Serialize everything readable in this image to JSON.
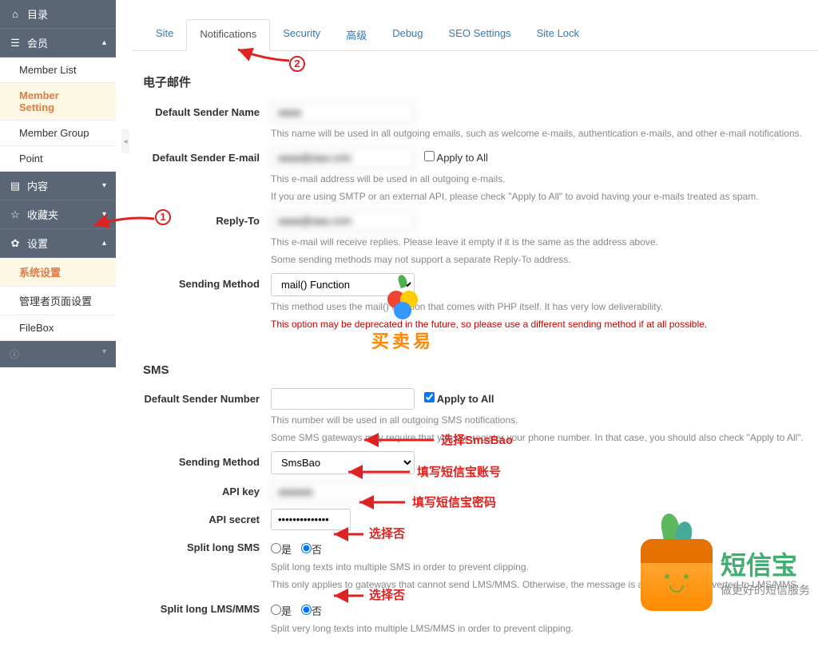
{
  "sidebar": {
    "section0": {
      "label": "目录"
    },
    "section1": {
      "label": "会员",
      "items": [
        {
          "label": "Member List"
        },
        {
          "label": "Member Setting"
        },
        {
          "label": "Member Group"
        },
        {
          "label": "Point"
        }
      ]
    },
    "section2": {
      "label": "内容"
    },
    "section3": {
      "label": "收藏夹"
    },
    "section4": {
      "label": "设置",
      "items": [
        {
          "label": "系统设置"
        },
        {
          "label": "管理者页面设置"
        },
        {
          "label": "FileBox"
        }
      ]
    }
  },
  "tabs": [
    {
      "label": "Site"
    },
    {
      "label": "Notifications"
    },
    {
      "label": "Security"
    },
    {
      "label": "高级"
    },
    {
      "label": "Debug"
    },
    {
      "label": "SEO Settings"
    },
    {
      "label": "Site Lock"
    }
  ],
  "email": {
    "title": "电子邮件",
    "sender_name": {
      "label": "Default Sender Name",
      "value": "aaaa",
      "desc": "This name will be used in all outgoing emails, such as welcome e-mails, authentication e-mails, and other e-mail notifications."
    },
    "sender_email": {
      "label": "Default Sender E-mail",
      "value": "aaaa@aaa.com",
      "apply_all": "Apply to All",
      "desc1": "This e-mail address will be used in all outgoing e-mails.",
      "desc2": "If you are using SMTP or an external API, please check \"Apply to All\" to avoid having your e-mails treated as spam."
    },
    "reply_to": {
      "label": "Reply-To",
      "value": "aaaa@aaa.com",
      "desc1": "This e-mail will receive replies. Please leave it empty if it is the same as the address above.",
      "desc2": "Some sending methods may not support a separate Reply-To address."
    },
    "sending_method": {
      "label": "Sending Method",
      "value": "mail() Function",
      "desc": "This method uses the mail() function that comes with PHP itself. It has very low deliverability.",
      "warn": "This option may be deprecated in the future, so please use a different sending method if at all possible."
    }
  },
  "sms": {
    "title": "SMS",
    "sender_number": {
      "label": "Default Sender Number",
      "value": "",
      "apply_all": "Apply to All",
      "desc1": "This number will be used in all outgoing SMS notifications.",
      "desc2": "Some SMS gateways may require that you pre-register your phone number. In that case, you should also check \"Apply to All\"."
    },
    "sending_method": {
      "label": "Sending Method",
      "value": "SmsBao"
    },
    "api_key": {
      "label": "API key",
      "value": "aaaaaa"
    },
    "api_secret": {
      "label": "API secret",
      "value": "••••••••••••••"
    },
    "split_sms": {
      "label": "Split long SMS",
      "yes": "是",
      "no": "否",
      "desc1": "Split long texts into multiple SMS in order to prevent clipping.",
      "desc2": "This only applies to gateways that cannot send LMS/MMS. Otherwise, the message is automatically converted to LMS/MMS."
    },
    "split_lms": {
      "label": "Split long LMS/MMS",
      "yes": "是",
      "no": "否",
      "desc1": "Split very long texts into multiple LMS/MMS in order to prevent clipping."
    }
  },
  "watermark": {
    "text": "买卖易"
  },
  "annotations": {
    "select_smsbao": "选择SmsBao",
    "fill_account": "填写短信宝账号",
    "fill_password": "填写短信宝密码",
    "select_no1": "选择否",
    "select_no2": "选择否"
  },
  "brand": {
    "title": "短信宝",
    "slogan": "做更好的短信服务"
  }
}
